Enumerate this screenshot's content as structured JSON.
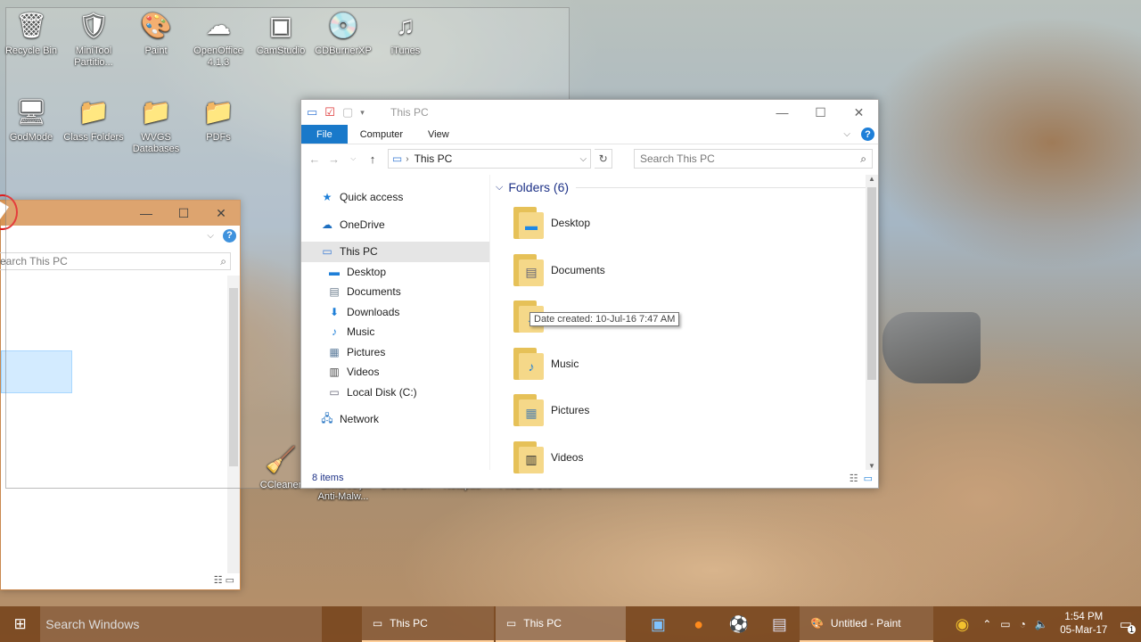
{
  "desktop": {
    "icons": [
      {
        "label": "Recycle Bin",
        "icon": "recycle-bin-icon",
        "glyph": "🗑"
      },
      {
        "label": "MiniTool Partitio...",
        "icon": "minitool-icon",
        "glyph": "🛡"
      },
      {
        "label": "Paint",
        "icon": "paint-icon",
        "glyph": "🎨"
      },
      {
        "label": "OpenOffice 4.1.3",
        "icon": "openoffice-icon",
        "glyph": "☁"
      },
      {
        "label": "CamStudio",
        "icon": "camstudio-icon",
        "glyph": "▣"
      },
      {
        "label": "CDBurnerXP",
        "icon": "cdburner-icon",
        "glyph": "💿"
      },
      {
        "label": "iTunes",
        "icon": "itunes-icon",
        "glyph": "♫"
      },
      {
        "label": "GodMode",
        "icon": "godmode-icon",
        "glyph": "🖥"
      },
      {
        "label": "Class Folders",
        "icon": "folder-icon",
        "glyph": "📁"
      },
      {
        "label": "WVGS Databases",
        "icon": "folder-icon",
        "glyph": "📁"
      },
      {
        "label": "PDFs",
        "icon": "folder-icon",
        "glyph": "📁"
      },
      {
        "label": "CCleaner",
        "icon": "ccleaner-icon",
        "glyph": "🧹"
      },
      {
        "label": "MalwareBy... Anti-Malw...",
        "icon": "malwarebytes-icon",
        "glyph": ""
      },
      {
        "label": "BlueGriffon",
        "icon": "bluegriffon-icon",
        "glyph": ""
      },
      {
        "label": "Notepad++",
        "icon": "notepadpp-icon",
        "glyph": ""
      },
      {
        "label": "FileZilla Client",
        "icon": "filezilla-icon",
        "glyph": ""
      }
    ]
  },
  "bg_window": {
    "search_placeholder": "earch This PC",
    "help": "?"
  },
  "window": {
    "title": "This PC",
    "tabs": [
      "File",
      "Computer",
      "View"
    ],
    "address": "This PC",
    "search_placeholder": "Search This PC",
    "help": "?",
    "nav": [
      {
        "label": "Quick access",
        "icon": "star-icon",
        "glyph": "★",
        "color": "#1e7fd8",
        "level": "top"
      },
      {
        "label": "OneDrive",
        "icon": "onedrive-icon",
        "glyph": "☁",
        "color": "#1e6fc0",
        "level": "top"
      },
      {
        "label": "This PC",
        "icon": "computer-icon",
        "glyph": "▭",
        "color": "#3a7bd5",
        "level": "top",
        "selected": true
      },
      {
        "label": "Desktop",
        "icon": "desktop-icon",
        "glyph": "▬",
        "color": "#1e7fd8",
        "level": "sub"
      },
      {
        "label": "Documents",
        "icon": "documents-icon",
        "glyph": "▤",
        "color": "#6a7b8c",
        "level": "sub"
      },
      {
        "label": "Downloads",
        "icon": "downloads-icon",
        "glyph": "⬇",
        "color": "#1e7fd8",
        "level": "sub"
      },
      {
        "label": "Music",
        "icon": "music-icon",
        "glyph": "♪",
        "color": "#1e7fd8",
        "level": "sub"
      },
      {
        "label": "Pictures",
        "icon": "pictures-icon",
        "glyph": "▦",
        "color": "#5a7a9a",
        "level": "sub"
      },
      {
        "label": "Videos",
        "icon": "videos-icon",
        "glyph": "▥",
        "color": "#444",
        "level": "sub"
      },
      {
        "label": "Local Disk (C:)",
        "icon": "drive-icon",
        "glyph": "▭",
        "color": "#667",
        "level": "sub"
      },
      {
        "label": "Network",
        "icon": "network-icon",
        "glyph": "🖧",
        "color": "#1e6fc0",
        "level": "top"
      }
    ],
    "group_title": "Folders (6)",
    "folders": [
      {
        "label": "Desktop",
        "icon": "desktop-folder-icon",
        "glyph": "▬",
        "color": "#1e88e5"
      },
      {
        "label": "Documents",
        "icon": "documents-folder-icon",
        "glyph": "▤",
        "color": "#667"
      },
      {
        "label": "",
        "icon": "downloads-folder-icon",
        "glyph": "⬇",
        "color": "#1e7fd8"
      },
      {
        "label": "Music",
        "icon": "music-folder-icon",
        "glyph": "♪",
        "color": "#1e7fd8"
      },
      {
        "label": "Pictures",
        "icon": "pictures-folder-icon",
        "glyph": "▦",
        "color": "#5a86aa"
      },
      {
        "label": "Videos",
        "icon": "videos-folder-icon",
        "glyph": "▥",
        "color": "#333"
      }
    ],
    "tooltip": "Date created: 10-Jul-16 7:47 AM",
    "status": "8 items"
  },
  "taskbar": {
    "search_placeholder": "Search Windows",
    "windows": [
      "This PC",
      "This PC"
    ],
    "paint_label": "Untitled - Paint",
    "time": "1:54 PM",
    "date": "05-Mar-17",
    "notification_count": "1"
  }
}
